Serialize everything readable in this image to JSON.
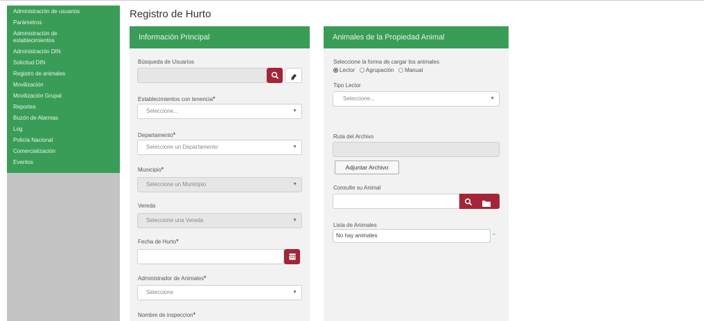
{
  "sidebar": {
    "items": [
      {
        "label": "Administración de usuarios"
      },
      {
        "label": "Parámetros"
      },
      {
        "label": "Administración de",
        "label2": "establecimientos"
      },
      {
        "label": "Administración DIN"
      },
      {
        "label": "Solicitud DIN"
      },
      {
        "label": "Registro de animales"
      },
      {
        "label": "Movilización"
      },
      {
        "label": "Movilización Grupal"
      },
      {
        "label": "Reportes"
      },
      {
        "label": "Buzón de Alarmas"
      },
      {
        "label": "Log"
      },
      {
        "label": "Policía Nacional"
      },
      {
        "label": "Comercialización"
      },
      {
        "label": "Eventos"
      }
    ]
  },
  "page": {
    "title": "Registro de Hurto"
  },
  "main_panel": {
    "title": "Información Principal",
    "fields": {
      "busqueda": {
        "label": "Búsqueda de Usuarios",
        "value": ""
      },
      "establecimientos": {
        "label": "Establecimientos con tenencia",
        "required": "*",
        "value": "Seleccione..."
      },
      "departamento": {
        "label": "Departamento",
        "required": "*",
        "value": "Seleccione un Departamento"
      },
      "municipio": {
        "label": "Municipio",
        "required": "*",
        "value": "Seleccione un Municipio"
      },
      "vereda": {
        "label": "Vereda",
        "value": "Seleccione una Vereda"
      },
      "fecha": {
        "label": "Fecha de Hurto",
        "required": "*",
        "value": ""
      },
      "administrador": {
        "label": "Administrador de Animales",
        "required": "*",
        "value": "Seleccione"
      },
      "inspeccion": {
        "label": "Nombre de inspeccion",
        "required": "*"
      }
    }
  },
  "animals_panel": {
    "title": "Animales de la Propiedad Animal",
    "load_mode_label": "Seleccione la forma de cargar los animales",
    "options": [
      {
        "label": "Lector",
        "selected": true
      },
      {
        "label": "Agrupación",
        "selected": false
      },
      {
        "label": "Manual",
        "selected": false
      }
    ],
    "tipo_lector": {
      "label": "Tipo Lector",
      "value": "Seleccione..."
    },
    "ruta": {
      "label": "Ruta del Archivo",
      "value": ""
    },
    "attach_button": "Adjuntar Archivo",
    "consulte": {
      "label": "Consulte su Animal",
      "value": ""
    },
    "lista": {
      "label": "Lista de Animales",
      "value": "No hay animales"
    }
  },
  "colors": {
    "green": "#3a9d57",
    "red": "#a32537",
    "sidebar_bg": "#c4c4c4"
  }
}
